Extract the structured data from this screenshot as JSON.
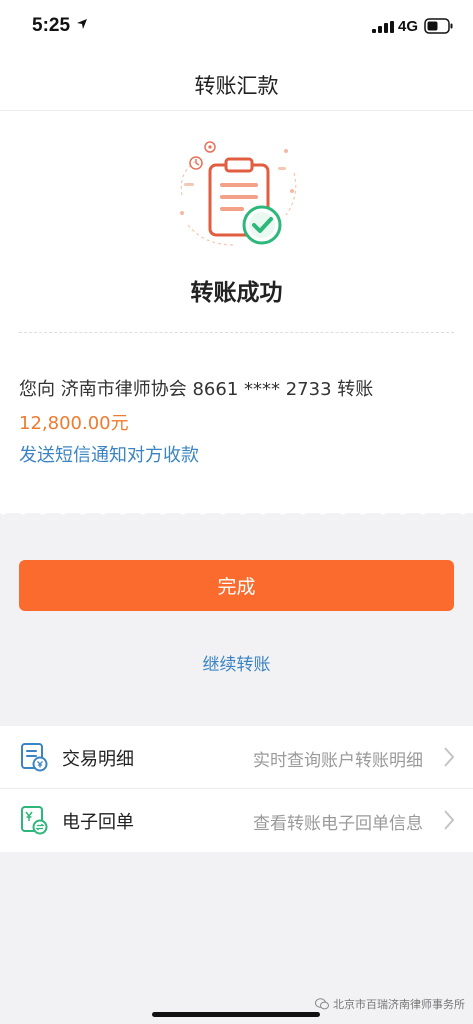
{
  "status_bar": {
    "time": "5:25",
    "network": "4G"
  },
  "nav": {
    "title": "转账汇款"
  },
  "result": {
    "title": "转账成功",
    "line_prefix": "您向",
    "recipient": "济南市律师协会",
    "account": "8661 **** 2733",
    "line_suffix": "转账",
    "amount": "12,800.00元",
    "sms_link": "发送短信通知对方收款"
  },
  "actions": {
    "done": "完成",
    "continue": "继续转账"
  },
  "menu": {
    "items": [
      {
        "label": "交易明细",
        "desc": "实时查询账户转账明细",
        "icon": "transaction-detail-icon"
      },
      {
        "label": "电子回单",
        "desc": "查看转账电子回单信息",
        "icon": "e-receipt-icon"
      }
    ]
  },
  "watermark": {
    "text": "北京市百瑞济南律师事务所"
  },
  "colors": {
    "accent_orange": "#fb6b2d",
    "amount_orange": "#f07b2e",
    "link_blue": "#3b84c4",
    "success_green": "#2db77a"
  }
}
